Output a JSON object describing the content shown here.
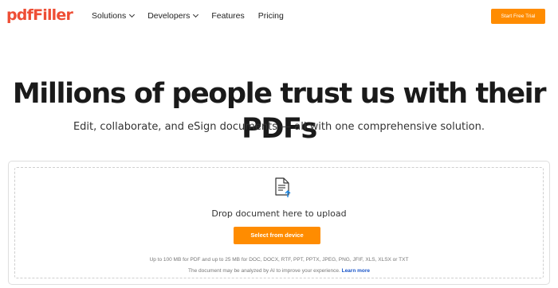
{
  "header": {
    "logo": "pdfFiller",
    "nav": [
      {
        "label": "Solutions",
        "has_dropdown": true
      },
      {
        "label": "Developers",
        "has_dropdown": true
      },
      {
        "label": "Features",
        "has_dropdown": false
      },
      {
        "label": "Pricing",
        "has_dropdown": false
      }
    ],
    "cta_label": "Start Free Trial"
  },
  "hero": {
    "title": "Millions of people trust us with their PDFs",
    "subtitle": "Edit, collaborate, and eSign documents — all with one comprehensive solution."
  },
  "upload": {
    "icon": "document-upload-icon",
    "drop_text": "Drop document here to upload",
    "button_label": "Select from device",
    "limits_text": "Up to 100 MB for PDF and up to 25 MB for DOC, DOCX, RTF, PPT, PPTX, JPEG, PNG, JFIF, XLS, XLSX or TXT",
    "ai_note": "The document may be analyzed by AI to improve your experience.",
    "learn_more": "Learn more"
  },
  "colors": {
    "brand": "#ee4e35",
    "accent": "#ff8c00",
    "link": "#1a56c9"
  }
}
